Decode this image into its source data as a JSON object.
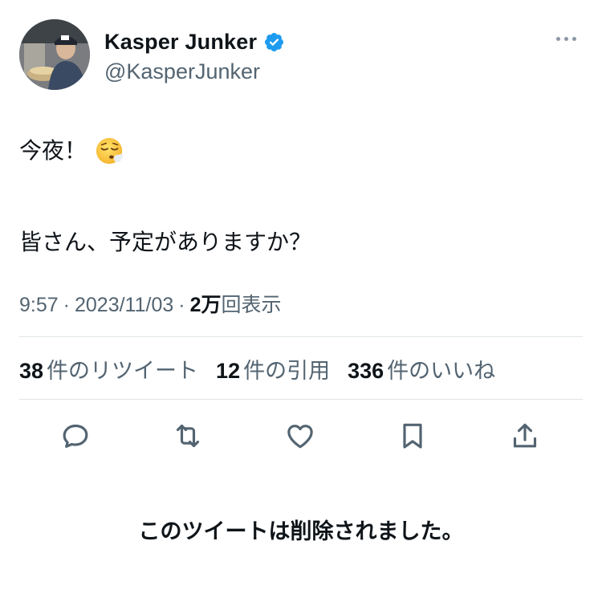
{
  "author": {
    "display_name": "Kasper Junker",
    "handle": "@KasperJunker",
    "verified": true,
    "avatar_icon": "profile-photo"
  },
  "tweet": {
    "line1": "今夜！",
    "line1_emoji": "face-exhaling-emoji",
    "line2": "皆さん、予定がありますか？"
  },
  "meta": {
    "time": "9:57",
    "separator": "·",
    "date": "2023/11/03",
    "views_count": "2万",
    "views_label": "回表示"
  },
  "stats": [
    {
      "count": "38",
      "label": "件のリツイート"
    },
    {
      "count": "12",
      "label": "件の引用"
    },
    {
      "count": "336",
      "label": "件のいいね"
    }
  ],
  "actions": [
    "reply-icon",
    "retweet-icon",
    "like-icon",
    "bookmark-icon",
    "share-icon"
  ],
  "deleted_notice": "このツイートは削除されました。",
  "colors": {
    "text_primary": "#0f1419",
    "text_secondary": "#536471",
    "verified_blue": "#1d9bf0",
    "divider": "#e1e5e8"
  }
}
